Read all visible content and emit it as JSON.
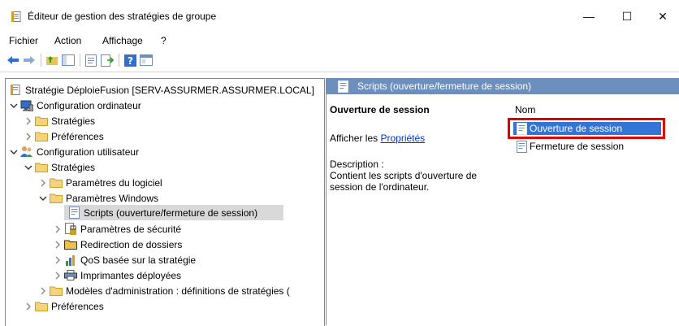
{
  "window": {
    "title": "Éditeur de gestion des stratégies de groupe",
    "minimize": "—",
    "maximize": "☐",
    "close": "✕"
  },
  "menu": [
    "Fichier",
    "Action",
    "Affichage",
    "?"
  ],
  "tree": {
    "root": "Stratégie DéploieFusion [SERV-ASSURMER.ASSURMER.LOCAL]",
    "computer_config": "Configuration ordinateur",
    "cc_strategies": "Stratégies",
    "cc_preferences": "Préférences",
    "user_config": "Configuration utilisateur",
    "uc_strategies": "Stratégies",
    "software_settings": "Paramètres du logiciel",
    "windows_settings": "Paramètres Windows",
    "scripts": "Scripts (ouverture/fermeture de session)",
    "security_settings": "Paramètres de sécurité",
    "folder_redirection": "Redirection de dossiers",
    "qos": "QoS basée sur la stratégie",
    "printers": "Imprimantes déployées",
    "admin_templates": "Modèles d'administration : définitions de stratégies (",
    "uc_preferences": "Préférences"
  },
  "right": {
    "header": "Scripts (ouverture/fermeture de session)",
    "section_title": "Ouverture de session",
    "show_prefix": "Afficher les ",
    "show_link": "Propriétés",
    "description_label": "Description :",
    "description_text": "Contient les scripts d'ouverture de session de l'ordinateur.",
    "column_name": "Nom",
    "items": [
      "Ouverture de session",
      "Fermeture de session"
    ]
  },
  "colors": {
    "header_blue": "#6d8fbd",
    "selection_blue": "#3375d7",
    "highlight_red": "#e00000",
    "link_blue": "#0033cc"
  }
}
